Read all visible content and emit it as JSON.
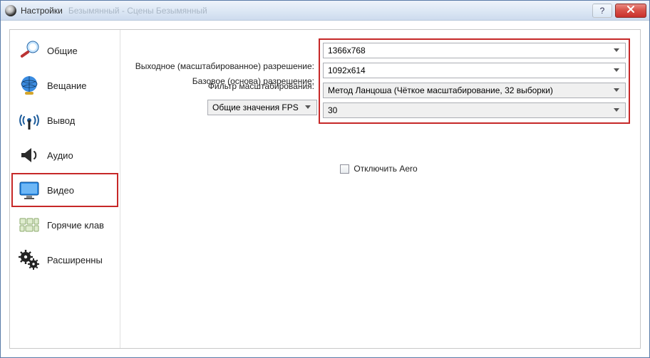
{
  "window": {
    "title": "Настройки",
    "ghost_title": "Безымянный - Сцены Безымянный"
  },
  "sidebar": {
    "items": [
      {
        "label": "Общие"
      },
      {
        "label": "Вещание"
      },
      {
        "label": "Вывод"
      },
      {
        "label": "Аудио"
      },
      {
        "label": "Видео"
      },
      {
        "label": "Горячие клав"
      },
      {
        "label": "Расширенны"
      }
    ]
  },
  "video": {
    "base_label": "Базовое (основа) разрешение:",
    "base_value": "1366x768",
    "output_label": "Выходное (масштабированное) разрешение:",
    "output_value": "1092x614",
    "filter_label": "Фильтр масштабирования:",
    "filter_value": "Метод Ланцоша (Чёткое масштабирование, 32 выборки)",
    "fps_type_value": "Общие значения FPS",
    "fps_value": "30",
    "disable_aero_label": "Отключить Aero"
  }
}
